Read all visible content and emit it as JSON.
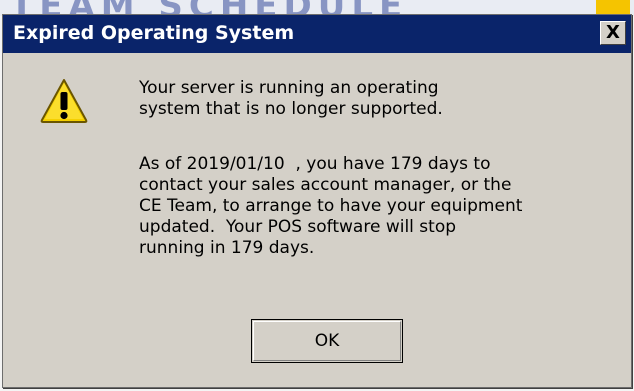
{
  "dialog": {
    "title": "Expired Operating System",
    "close_label": "X",
    "icon": "warning-icon",
    "message_line1": "Your server is running an operating\nsystem that is no longer supported.",
    "message_line2": "As of 2019/01/10  , you have 179 days to\ncontact your sales account manager, or the\nCE Team, to arrange to have your equipment\nupdated.  Your POS software will stop\nrunning in 179 days.",
    "ok_label": "OK"
  },
  "colors": {
    "titlebar": "#0a246a",
    "dialog_face": "#d4d0c8",
    "warning_yellow": "#f5d000"
  }
}
